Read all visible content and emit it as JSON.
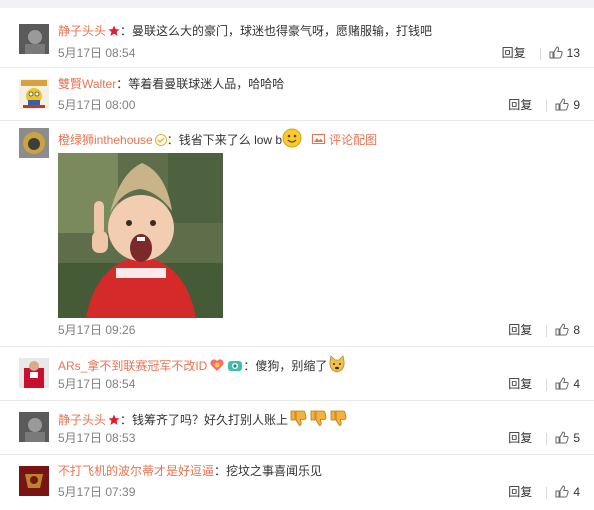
{
  "colors": {
    "username": "#eb7350",
    "meta": "#808080",
    "text": "#333333"
  },
  "comments": [
    {
      "user": "静子头头",
      "text": "曼联这么大的豪门，球迷也得豪气呀，愿赌服输，打钱吧",
      "date": "5月17日 08:54",
      "likes": "13"
    },
    {
      "user": "雙賢Walter",
      "text": "等着看曼联球迷人品，哈哈哈",
      "date": "5月17日 08:00",
      "likes": "9"
    },
    {
      "user": "橙绿狮inthehouse",
      "text": "钱省下来了么 low b",
      "photo_link": "评论配图",
      "date": "5月17日 09:26",
      "likes": "8"
    },
    {
      "user": "ARs_拿不到联赛冠军不改ID",
      "text": "傻狗，别缩了",
      "date": "5月17日 08:54",
      "likes": "4"
    },
    {
      "user": "静子头头",
      "text": "钱筹齐了吗？好久打别人账上",
      "date": "5月17日 08:53",
      "likes": "5"
    },
    {
      "user": "不打飞机的波尔蒂才是好逗逼",
      "text": "挖坟之事喜闻乐见",
      "date": "5月17日 07:39",
      "likes": "4"
    }
  ],
  "reply_label": "回复",
  "colon": "："
}
